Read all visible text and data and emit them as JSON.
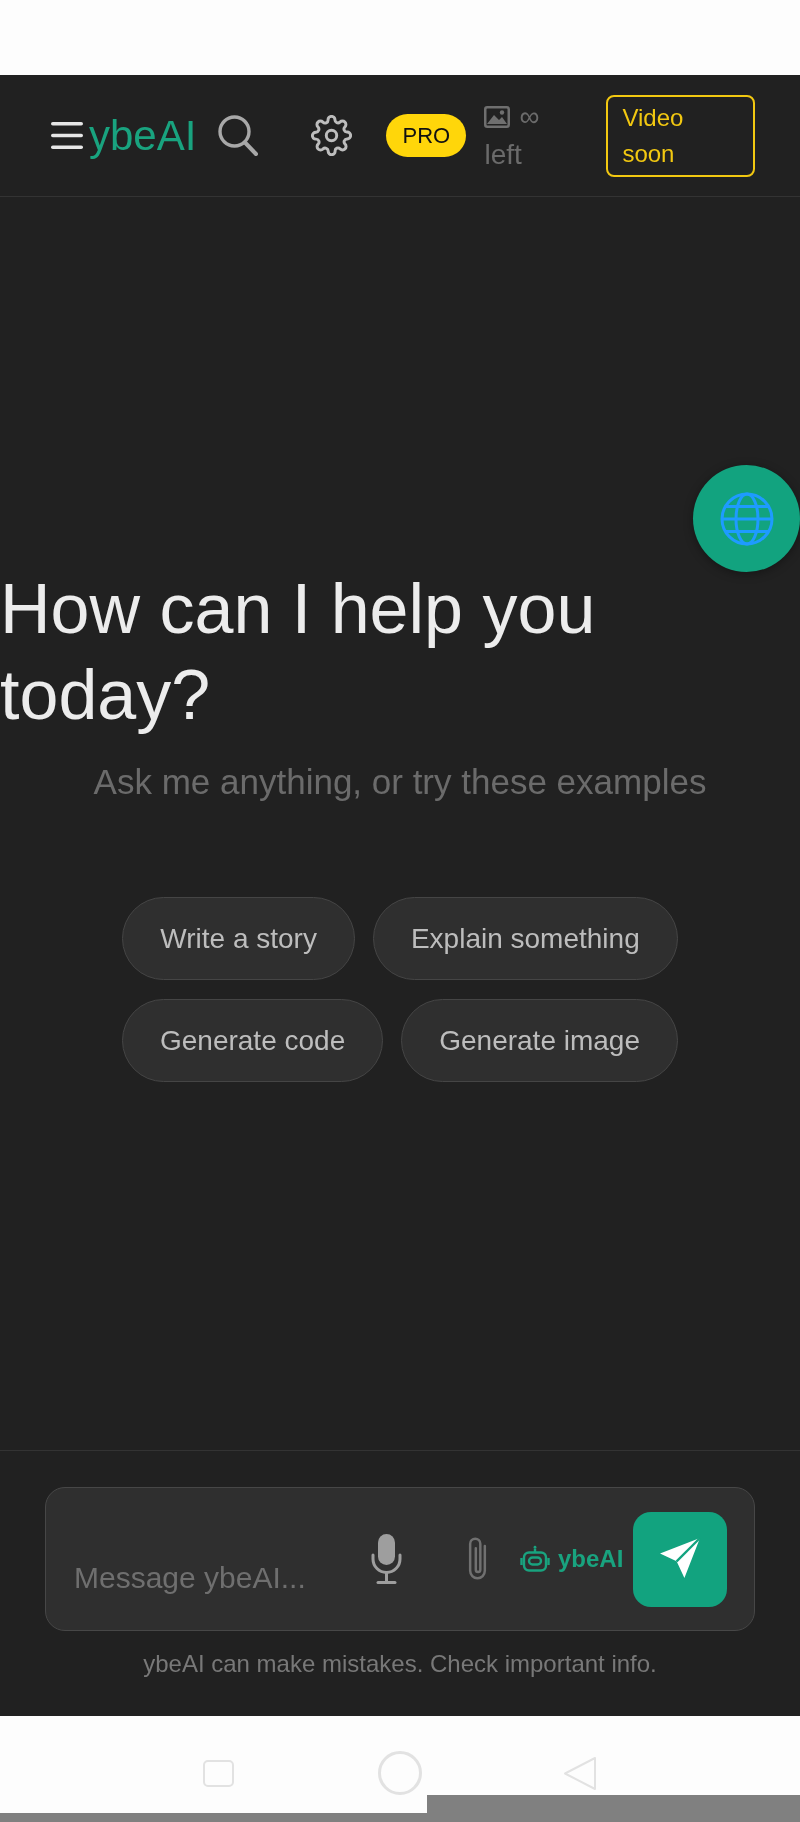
{
  "header": {
    "logo": "ybeAI",
    "plan_badge": "PRO",
    "image_quota": {
      "value": "∞",
      "label": "left"
    },
    "video_badge": "Video soon"
  },
  "hero": {
    "title": "How can I help you today?",
    "subtitle": "Ask me anything, or try these examples"
  },
  "suggestions": [
    "Write a story",
    "Explain something",
    "Generate code",
    "Generate image"
  ],
  "composer": {
    "placeholder": "Message ybeAI...",
    "model_label": "ybeAI"
  },
  "disclaimer": "ybeAI can make mistakes. Check important info."
}
